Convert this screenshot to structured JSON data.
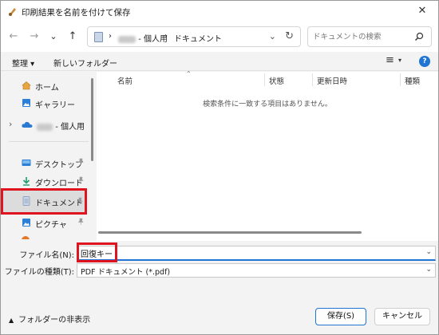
{
  "window": {
    "title": "印刷結果を名前を付けて保存",
    "close_glyph": "✕"
  },
  "nav": {
    "back": "←",
    "forward": "→",
    "recent": "⌄",
    "up": "↑",
    "address": {
      "sep1": "›",
      "owner_suffix": "- 個人用",
      "sep2": "›",
      "current": "ドキュメント",
      "dropdown": "⌄",
      "refresh": "↻"
    },
    "search_placeholder": "ドキュメントの検索"
  },
  "toolbar": {
    "organize": "整理 ▾",
    "new_folder": "新しいフォルダー",
    "view_glyph": "≡",
    "view_dropdown": "▾",
    "help": "?"
  },
  "sidebar": {
    "items": [
      {
        "label": "ホーム",
        "icon": "home-icon"
      },
      {
        "label": "ギャラリー",
        "icon": "gallery-icon"
      },
      {
        "label": "- 個人用",
        "icon": "cloud-icon",
        "expander": "›"
      },
      {
        "label": "デスクトップ",
        "icon": "desktop-icon"
      },
      {
        "label": "ダウンロード",
        "icon": "download-icon"
      },
      {
        "label": "ドキュメント",
        "icon": "document-icon"
      },
      {
        "label": "ピクチャ",
        "icon": "pictures-icon"
      }
    ]
  },
  "content": {
    "columns": [
      "名前",
      "状態",
      "更新日時",
      "種類"
    ],
    "empty_message": "検索条件に一致する項目はありません。"
  },
  "form": {
    "filename_label": "ファイル名(N):",
    "filename_value": "回復キー",
    "filetype_label": "ファイルの種類(T):",
    "filetype_value": "PDF ドキュメント (*.pdf)",
    "dropdown": "⌄"
  },
  "footer": {
    "hide_folders": "フォルダーの非表示",
    "caret": "▲",
    "save": "保存(S)",
    "cancel": "キャンセル"
  },
  "colors": {
    "accent": "#1f74d4",
    "highlight": "#e0141e"
  }
}
